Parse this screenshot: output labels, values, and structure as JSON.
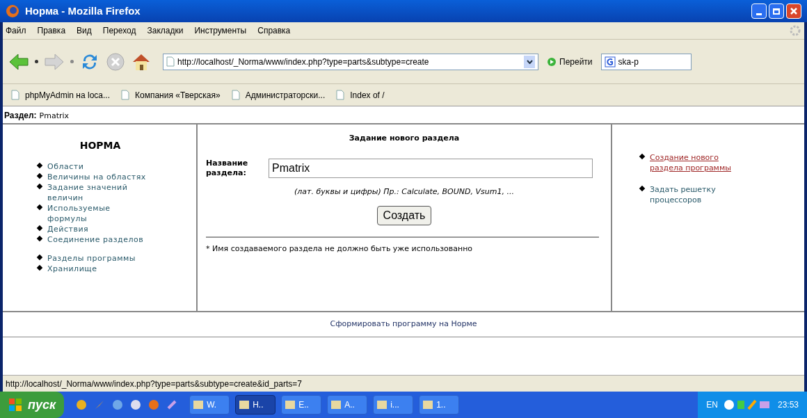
{
  "window": {
    "title": "Норма - Mozilla Firefox"
  },
  "menu": [
    "Файл",
    "Правка",
    "Вид",
    "Переход",
    "Закладки",
    "Инструменты",
    "Справка"
  ],
  "toolbar": {
    "address": "http://localhost/_Norma/www/index.php?type=parts&subtype=create",
    "go_label": "Перейти",
    "search_value": "ska-p"
  },
  "bookmarks": [
    "phpMyAdmin на loca...",
    "Компания «Тверская»",
    "Администраторски...",
    "Index of /"
  ],
  "page": {
    "section_label": "Раздел:",
    "section_value": "Pmatrix",
    "left_nav": {
      "title": "НОРМА",
      "groups": [
        [
          "Области",
          "Величины на областях",
          "Задание значений величин",
          "Используемые формулы",
          "Действия",
          "Соединение разделов"
        ],
        [
          "Разделы программы",
          "Хранилище"
        ]
      ]
    },
    "form": {
      "heading": "Задание нового раздела",
      "field_label": "Название раздела:",
      "field_value": "Pmatrix",
      "hint": "(лат. буквы и цифры) Пр.: Calculate, BOUND, Vsum1, ...",
      "button": "Создать",
      "note": "* Имя создаваемого раздела не должно быть уже использованно"
    },
    "right_links": [
      {
        "label": "Создание нового раздела программы",
        "selected": true
      },
      {
        "label": "Задать решетку процессоров",
        "selected": false
      }
    ],
    "footer_link": "Сформировать программу на Норме"
  },
  "status_bar": "http://localhost/_Norma/www/index.php?type=parts&subtype=create&id_parts=7",
  "taskbar": {
    "start": "пуск",
    "tasks": [
      {
        "label": "W.",
        "selected": false
      },
      {
        "label": "H..",
        "selected": true
      },
      {
        "label": "E..",
        "selected": false
      },
      {
        "label": "A..",
        "selected": false
      },
      {
        "label": "i...",
        "selected": false
      },
      {
        "label": "1..",
        "selected": false
      }
    ],
    "language": "EN",
    "clock": "23:53"
  }
}
